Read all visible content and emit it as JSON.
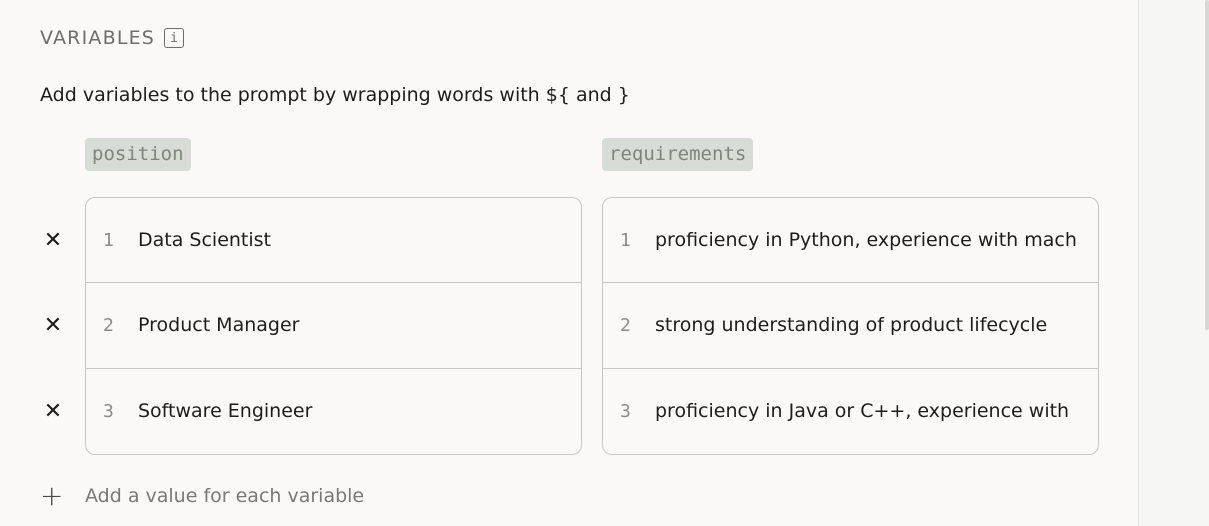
{
  "section": {
    "title": "VARIABLES",
    "info_glyph": "i"
  },
  "description": "Add variables to the prompt by wrapping words with ${ and }",
  "variables": [
    {
      "name": "position",
      "values": [
        {
          "index": "1",
          "value": "Data Scientist"
        },
        {
          "index": "2",
          "value": "Product Manager"
        },
        {
          "index": "3",
          "value": "Software Engineer"
        }
      ]
    },
    {
      "name": "requirements",
      "values": [
        {
          "index": "1",
          "value": "proficiency in Python, experience with machine learning"
        },
        {
          "index": "2",
          "value": "strong understanding of product lifecycle"
        },
        {
          "index": "3",
          "value": "proficiency in Java or C++, experience with"
        }
      ]
    }
  ],
  "row_actions": {
    "delete_glyph": "✕"
  },
  "add_value": {
    "glyph": "+",
    "label": "Add a value for each variable"
  },
  "colors": {
    "chip_bg": "#d7dcd5",
    "chip_text": "#7d8679",
    "border": "#c9c8c4"
  }
}
